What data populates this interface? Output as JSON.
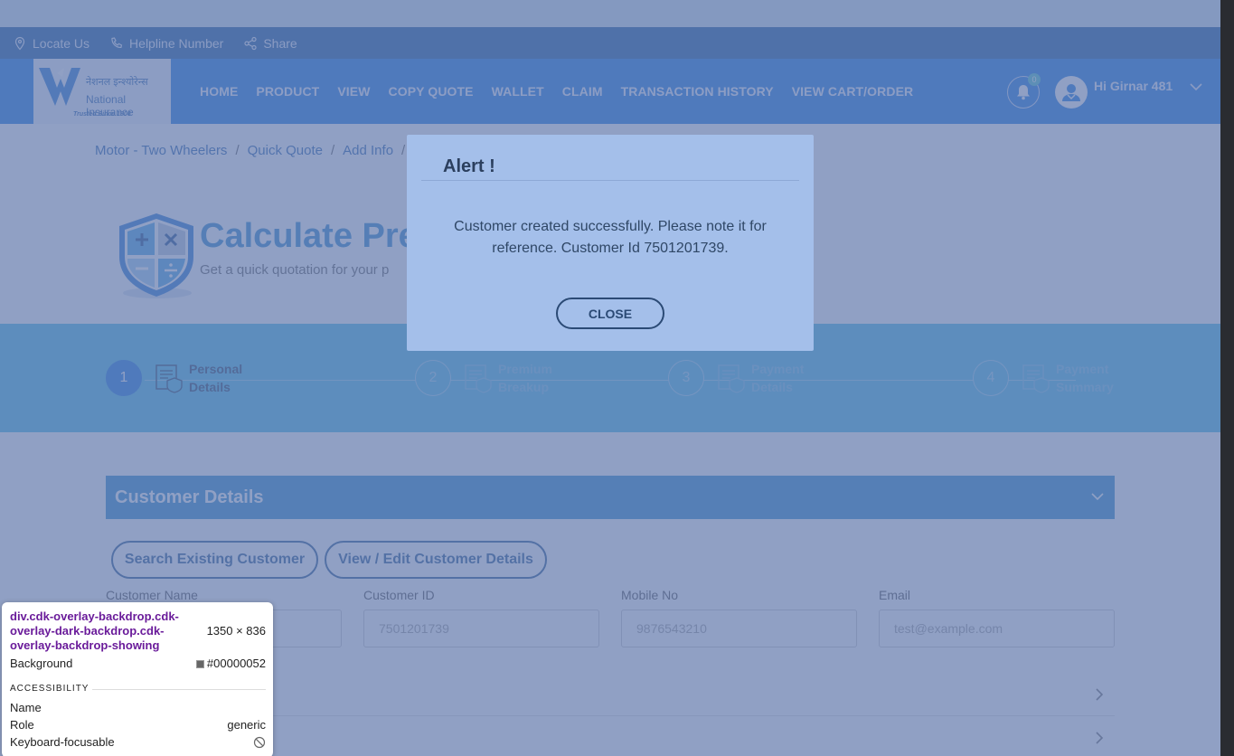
{
  "utility": {
    "locate": "Locate Us",
    "helpline": "Helpline Number",
    "share": "Share"
  },
  "logo": {
    "hindi": "नेशनल इन्श्योरेन्स",
    "english": "National Insurance",
    "tagline": "Trusted Since 1906"
  },
  "nav": {
    "items": [
      "HOME",
      "PRODUCT",
      "VIEW",
      "COPY QUOTE",
      "WALLET",
      "CLAIM",
      "TRANSACTION HISTORY",
      "VIEW CART/ORDER"
    ],
    "notification_count": "0",
    "greeting": "Hi Girnar 481"
  },
  "breadcrumb": [
    "Motor - Two Wheelers",
    "Quick Quote",
    "Add Info"
  ],
  "hero": {
    "title": "Calculate Pre",
    "subtitle": "Get a quick quotation for your p"
  },
  "steps": [
    {
      "num": "1",
      "line1": "Personal",
      "line2": "Details"
    },
    {
      "num": "2",
      "line1": "Premium",
      "line2": "Breakup"
    },
    {
      "num": "3",
      "line1": "Payment",
      "line2": "Details"
    },
    {
      "num": "4",
      "line1": "Payment",
      "line2": "Summary"
    }
  ],
  "customer": {
    "section_title": "Customer Details",
    "search_btn": "Search Existing Customer",
    "edit_btn": "View / Edit Customer Details",
    "labels": {
      "name": "Customer Name",
      "id": "Customer ID",
      "mobile": "Mobile No",
      "email": "Email"
    },
    "values": {
      "name": "",
      "id": "7501201739",
      "mobile": "9876543210",
      "email": "test@example.com"
    }
  },
  "modal": {
    "title": "Alert !",
    "message": "Customer created successfully. Please note it for reference. Customer Id 7501201739.",
    "close": "CLOSE"
  },
  "devtools": {
    "selector": "div.cdk-overlay-backdrop.cdk-overlay-dark-backdrop.cdk-overlay-backdrop-showing",
    "size": "1350 × 836",
    "background_label": "Background",
    "background_value": "#00000052",
    "section": "ACCESSIBILITY",
    "name_label": "Name",
    "role_label": "Role",
    "role_value": "generic",
    "focus_label": "Keyboard-focusable"
  },
  "colors": {
    "nav_blue": "#0c6ee0",
    "utility_blue": "#0b4f9a",
    "stepper_cyan": "#3eb8e6",
    "section_blue": "#1f86c8",
    "backdrop": "#00000052"
  }
}
